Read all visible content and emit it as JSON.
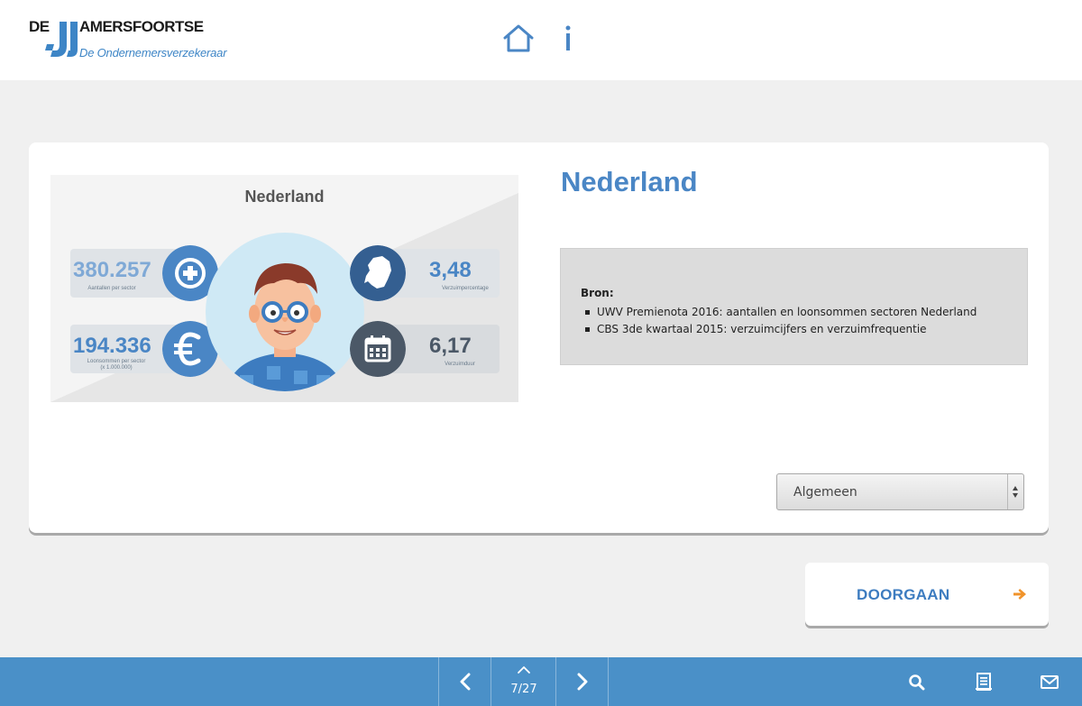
{
  "header": {
    "logo": {
      "brand_de": "DE",
      "brand_name": "AMERSFOORTSE",
      "tagline": "De Ondernemersverzekeraar"
    },
    "icons": {
      "home": "home-icon",
      "info": "info-icon"
    }
  },
  "infographic": {
    "title": "Nederland",
    "stats": {
      "insured_count": {
        "value": "380.257",
        "label": "Aantallen per sector",
        "icon": "plus-icon"
      },
      "payroll": {
        "value": "194.336",
        "label_line1": "Loonsommen per sector",
        "label_line2": "(x 1.000.000)",
        "icon": "euro-icon"
      },
      "absence_percentage": {
        "value": "3,48",
        "label": "Verzuimpercentage",
        "icon": "netherlands-map-icon"
      },
      "absence_duration": {
        "value": "6,17",
        "label": "Verzuimduur",
        "icon": "calendar-icon"
      }
    },
    "colors": {
      "blue": "#4a86c5",
      "dark": "#4b5867",
      "stat_bg": "#dfe3e7"
    }
  },
  "content": {
    "title": "Nederland",
    "source_heading": "Bron:",
    "sources": [
      "UWV Premienota 2016: aantallen en  loonsommen sectoren Nederland",
      "CBS 3de kwartaal 2015: verzuimcijfers en verzuimfrequentie"
    ],
    "select": {
      "selected": "Algemeen"
    }
  },
  "continue_button": {
    "label": "DOORGAAN",
    "arrow_icon": "arrow-right-icon",
    "arrow_color": "#f0932b"
  },
  "bottom_bar": {
    "page_indicator": "7/27",
    "icons": {
      "prev": "chevron-left-icon",
      "up": "chevron-up-icon",
      "next": "chevron-right-icon",
      "search": "search-icon",
      "document": "document-icon",
      "mail": "mail-icon"
    },
    "color": "#4a90c8"
  }
}
